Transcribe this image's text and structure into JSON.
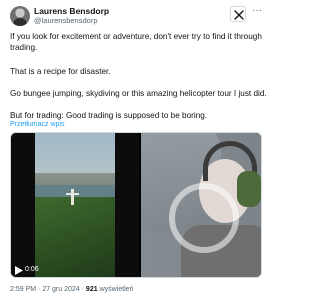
{
  "author": {
    "name": "Laurens Bensdorp",
    "handle": "@laurensbensdorp"
  },
  "tweet": {
    "paragraphs": [
      "If you look for excitement or adventure, don't ever try to find it through trading.",
      "That is a recipe for disaster.",
      "Go bungee jumping, skydiving or this amazing helicopter tour I just did.",
      "But for trading: Good trading is supposed to be boring."
    ],
    "translate_label": "Przetłumacz wpis"
  },
  "media": {
    "video_time": "0:06"
  },
  "meta": {
    "time": "2:59 PM",
    "date": "27 gru 2024",
    "views_count": "921",
    "views_label": "wyświetleń"
  },
  "icons": {
    "x_logo": "x-logo-icon",
    "more": "more-icon",
    "play": "play-icon"
  }
}
